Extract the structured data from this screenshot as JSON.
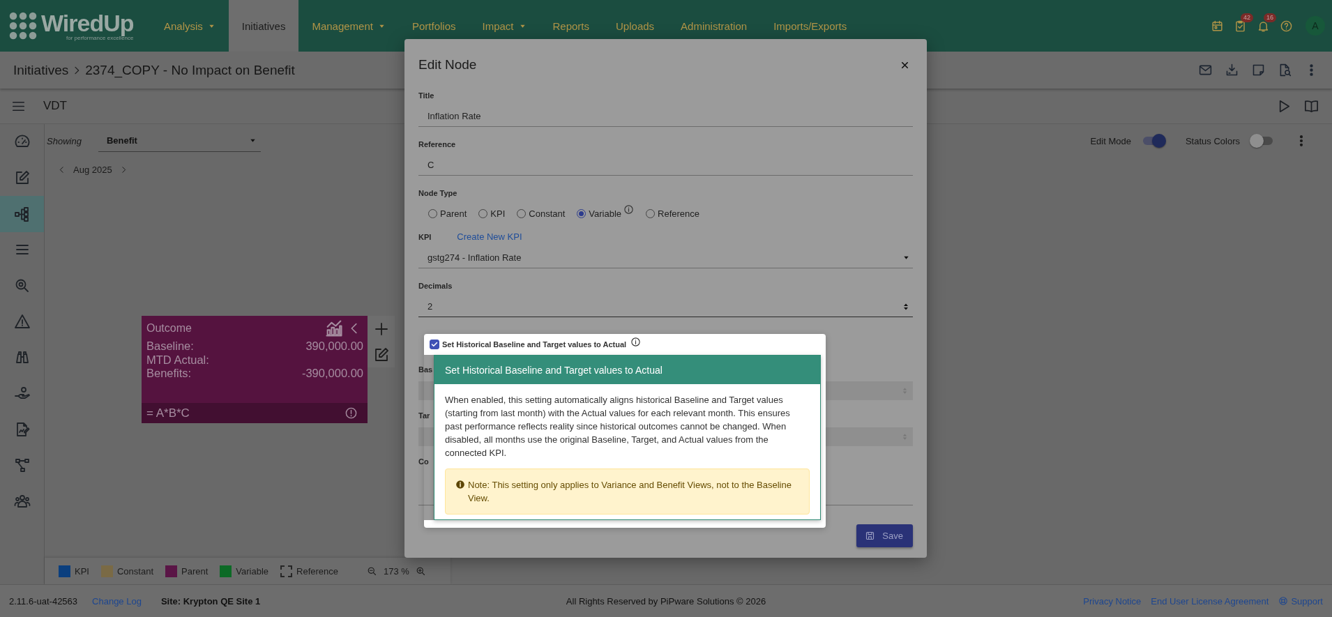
{
  "app": {
    "name": "WiredUp",
    "tagline": "for performance excellence"
  },
  "nav": [
    {
      "label": "Analysis",
      "dropdown": true,
      "selected": false
    },
    {
      "label": "Initiatives",
      "dropdown": false,
      "selected": true
    },
    {
      "label": "Management",
      "dropdown": true,
      "selected": false
    },
    {
      "label": "Portfolios",
      "dropdown": false,
      "selected": false
    },
    {
      "label": "Impact",
      "dropdown": true,
      "selected": false
    },
    {
      "label": "Reports",
      "dropdown": false,
      "selected": false
    },
    {
      "label": "Uploads",
      "dropdown": false,
      "selected": false
    },
    {
      "label": "Administration",
      "dropdown": false,
      "selected": false
    },
    {
      "label": "Imports/Exports",
      "dropdown": false,
      "selected": false
    }
  ],
  "header_actions": [
    {
      "kind": "calendar"
    },
    {
      "kind": "tasks",
      "badge": "42"
    },
    {
      "kind": "bell",
      "badge": "16"
    },
    {
      "kind": "help"
    },
    {
      "kind": "avatar",
      "label": "A"
    }
  ],
  "breadcrumb": {
    "parent": "Initiatives",
    "current": "2374_COPY - No Impact on Benefit"
  },
  "page_actions": [
    {
      "kind": "mail"
    },
    {
      "kind": "download"
    },
    {
      "kind": "note"
    },
    {
      "kind": "docsearch"
    },
    {
      "kind": "more"
    }
  ],
  "view": {
    "title": "VDT",
    "actions": [
      {
        "kind": "play"
      },
      {
        "kind": "book"
      }
    ]
  },
  "sidebar": [
    {
      "kind": "gauge",
      "selected": false
    },
    {
      "kind": "edit",
      "selected": false
    },
    {
      "kind": "tree",
      "selected": true
    },
    {
      "kind": "list",
      "selected": false
    },
    {
      "kind": "magnifier",
      "selected": false
    },
    {
      "kind": "warning",
      "selected": false
    },
    {
      "kind": "binoculars",
      "selected": false
    },
    {
      "kind": "hand",
      "selected": false
    },
    {
      "kind": "docedit",
      "selected": false
    },
    {
      "kind": "flow",
      "selected": false
    },
    {
      "kind": "people",
      "selected": false
    }
  ],
  "toolbar": {
    "showing_label": "Showing",
    "showing_value": "Benefit",
    "period": "Aug 2025",
    "edit_mode": {
      "label": "Edit Mode",
      "on": true
    },
    "status_colors": {
      "label": "Status Colors",
      "on": false
    }
  },
  "nodes": [
    {
      "title": "Outcome",
      "color": "#55133f",
      "formula": "= A*B*C",
      "rows": [
        {
          "label": "Baseline:",
          "value": "390,000.00"
        },
        {
          "label": "MTD Actual:"
        },
        {
          "label": "Benefits:",
          "value": "-390,000.00"
        }
      ]
    }
  ],
  "legend": [
    {
      "label": "KPI",
      "kind": "solid",
      "color": "#0b3f7e"
    },
    {
      "label": "Constant",
      "kind": "solid",
      "color": "#7a6a45"
    },
    {
      "label": "Parent",
      "kind": "solid",
      "color": "#5a1546"
    },
    {
      "label": "Variable",
      "kind": "solid",
      "color": "#0d6a26"
    },
    {
      "label": "Reference",
      "kind": "dashed"
    }
  ],
  "zoom": "173 %",
  "footer": {
    "version": "2.11.6-uat-42563",
    "changelog": "Change Log",
    "site": "Site: Krypton QE Site 1",
    "copyright": "All Rights Reserved by PiPware Solutions © 2026",
    "links": [
      {
        "label": "Privacy Notice"
      },
      {
        "label": "End User License Agreement"
      },
      {
        "label": "Support",
        "icon": true
      }
    ]
  },
  "dialog": {
    "title": "Edit Node",
    "fields": [
      {
        "kind": "text",
        "label": "Title",
        "value": "Inflation Rate"
      },
      {
        "kind": "text",
        "label": "Reference",
        "value": "C"
      },
      {
        "kind": "radio",
        "label": "Node Type",
        "options": [
          {
            "label": "Parent",
            "selected": false
          },
          {
            "label": "KPI",
            "selected": false
          },
          {
            "label": "Constant",
            "selected": false
          },
          {
            "label": "Variable",
            "selected": true,
            "info": true
          },
          {
            "label": "Reference",
            "selected": false
          }
        ]
      },
      {
        "kind": "select",
        "label": "KPI",
        "link": "Create New KPI",
        "value": "gstg274 - Inflation Rate"
      },
      {
        "kind": "number",
        "label": "Decimals",
        "value": "2"
      },
      {
        "kind": "checkbox",
        "label": "Set Historical Baseline and Target values to Actual",
        "checked": true,
        "info": true
      },
      {
        "kind": "number",
        "label": "Bas",
        "disabled": true
      },
      {
        "kind": "number",
        "label": "Tar",
        "disabled": true
      },
      {
        "kind": "textarea",
        "label": "Co"
      }
    ],
    "save": "Save",
    "popover": {
      "title": "Set Historical Baseline and Target values to Actual",
      "body": "When enabled, this setting automatically aligns historical Baseline and Target values (starting from last month) with the Actual values for each relevant month. This ensures past performance reflects reality since historical outcomes cannot be changed. When disabled, all months use the original Baseline, Target, and Actual values from the connected KPI.",
      "note": "Note: This setting only applies to Variance and Benefit Views, not to the Baseline View."
    }
  }
}
